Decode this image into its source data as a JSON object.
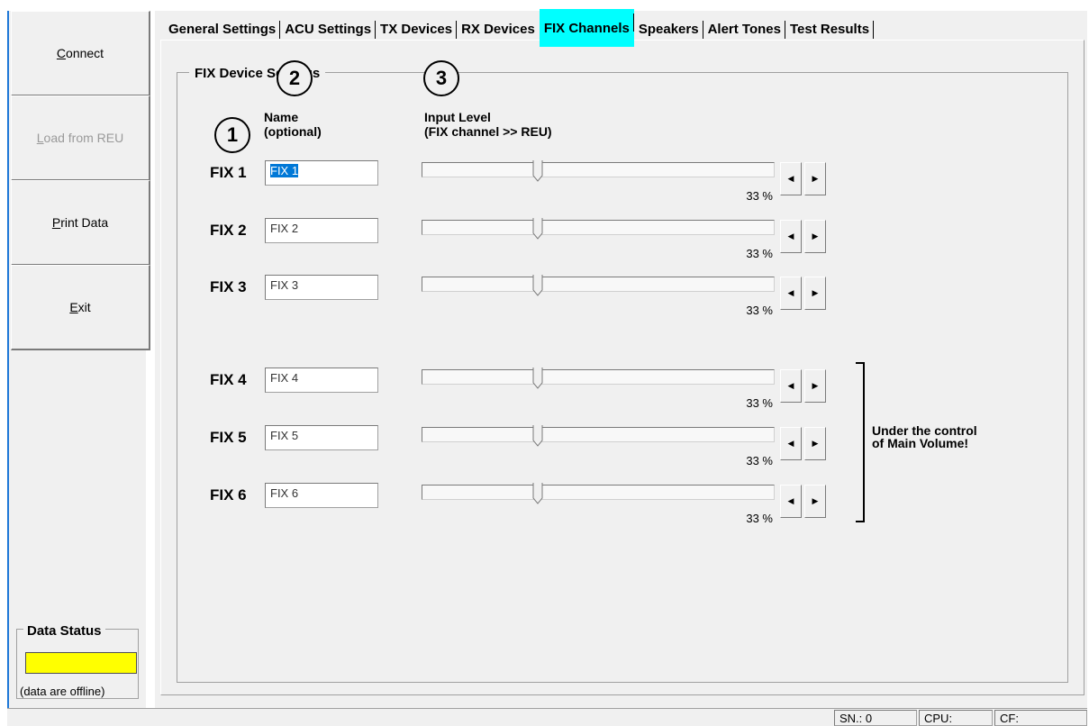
{
  "sidebar": {
    "buttons": [
      {
        "label_pre": "",
        "label_u": "C",
        "label_post": "onnect",
        "enabled": true
      },
      {
        "label_pre": "",
        "label_u": "L",
        "label_post": "oad from REU",
        "enabled": false
      },
      {
        "label_pre": "",
        "label_u": "P",
        "label_post": "rint Data",
        "enabled": true
      },
      {
        "label_pre": "",
        "label_u": "E",
        "label_post": "xit",
        "enabled": true
      }
    ],
    "data_status": {
      "title": "Data Status",
      "color": "#ffff00",
      "text": "(data are offline)"
    }
  },
  "tabs": [
    {
      "label": "General Settings"
    },
    {
      "label": "ACU Settings"
    },
    {
      "label": "TX Devices"
    },
    {
      "label": "RX Devices"
    },
    {
      "label": "FIX Channels",
      "active": true
    },
    {
      "label": "Speakers"
    },
    {
      "label": "Alert Tones"
    },
    {
      "label": "Test Results"
    }
  ],
  "fix_panel": {
    "group_title": "FIX Device Settings",
    "col_name_line1": "Name",
    "col_name_line2": "(optional)",
    "col_level_line1": "Input Level",
    "col_level_line2": "(FIX channel >> REU)",
    "callouts": [
      "1",
      "2",
      "3"
    ],
    "bracket_note_line1": "Under the control",
    "bracket_note_line2": "of Main Volume!",
    "channels": [
      {
        "label": "FIX 1",
        "name": "FIX 1",
        "selected": true,
        "level_percent": 33,
        "level_text": "33 %"
      },
      {
        "label": "FIX 2",
        "name": "FIX 2",
        "selected": false,
        "level_percent": 33,
        "level_text": "33 %"
      },
      {
        "label": "FIX 3",
        "name": "FIX 3",
        "selected": false,
        "level_percent": 33,
        "level_text": "33 %"
      },
      {
        "label": "FIX 4",
        "name": "FIX 4",
        "selected": false,
        "level_percent": 33,
        "level_text": "33 %"
      },
      {
        "label": "FIX 5",
        "name": "FIX 5",
        "selected": false,
        "level_percent": 33,
        "level_text": "33 %"
      },
      {
        "label": "FIX 6",
        "name": "FIX 6",
        "selected": false,
        "level_percent": 33,
        "level_text": "33 %"
      }
    ]
  },
  "statusbar": {
    "sn": "SN.: 0",
    "cpu": "CPU:",
    "cf": "CF:"
  }
}
